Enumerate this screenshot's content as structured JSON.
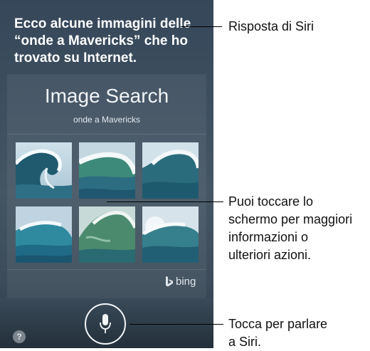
{
  "siri_response": {
    "line1": "Ecco alcune immagini delle",
    "line2": "“onde a Mavericks” che ho",
    "line3": "trovato su Internet."
  },
  "image_search": {
    "title": "Image Search",
    "query": "onde a Mavericks",
    "provider": "bing",
    "thumbnails": [
      "wave-barrel-1",
      "wave-crest-2",
      "wave-curl-3",
      "wave-crest-4",
      "wave-face-5",
      "wave-spray-6"
    ]
  },
  "controls": {
    "mic_icon": "microphone-icon",
    "help_label": "?"
  },
  "callouts": {
    "siri": "Risposta di Siri",
    "screen_line1": "Puoi toccare lo",
    "screen_line2": "schermo per maggiori",
    "screen_line3": "informazioni o",
    "screen_line4": "ulteriori azioni.",
    "speak_line1": "Tocca per parlare",
    "speak_line2": "a Siri."
  },
  "colors": {
    "screen_bg": "#3b4c5d",
    "text": "#ffffff",
    "callout_text": "#111111"
  }
}
